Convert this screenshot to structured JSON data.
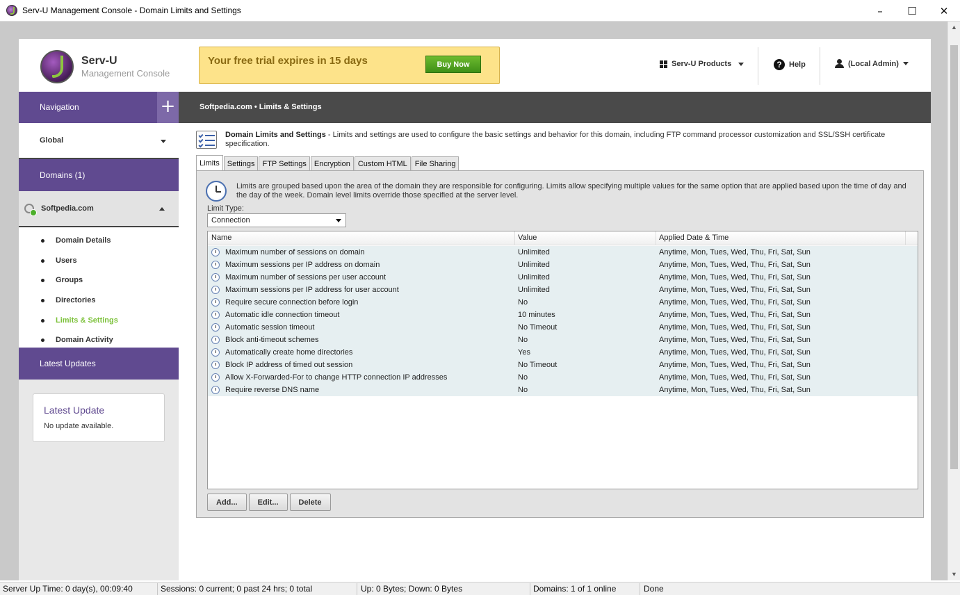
{
  "window": {
    "title": "Serv-U Management Console - Domain Limits and Settings",
    "minimize": "–",
    "maximize": "☐",
    "close": "✕"
  },
  "header": {
    "brand_name": "Serv-U",
    "brand_sub": "Management Console",
    "trial_text": "Your free trial expires in 15 days",
    "buy_label": "Buy Now",
    "products_label": "Serv-U Products",
    "help_label": "Help",
    "user_label": "(Local Admin)"
  },
  "sidebar": {
    "navigation_label": "Navigation",
    "plus": "+",
    "global_label": "Global",
    "domains_label": "Domains (1)",
    "domain_name": "Softpedia.com",
    "items": [
      {
        "label": "Domain Details"
      },
      {
        "label": "Users"
      },
      {
        "label": "Groups"
      },
      {
        "label": "Directories"
      },
      {
        "label": "Limits & Settings",
        "active": true
      },
      {
        "label": "Domain Activity"
      }
    ],
    "updates_label": "Latest Updates",
    "update_card": {
      "title": "Latest Update",
      "text": "No update available."
    }
  },
  "main": {
    "breadcrumb": "Softpedia.com • Limits & Settings",
    "desc_title": "Domain Limits and Settings",
    "desc_text": " - Limits and settings are used to configure the basic settings and behavior for this domain, including FTP command processor customization and SSL/SSH certificate specification.",
    "tabs": [
      "Limits",
      "Settings",
      "FTP Settings",
      "Encryption",
      "Custom HTML",
      "File Sharing"
    ],
    "active_tab": "Limits",
    "panel_desc": "Limits are grouped based upon the area of the domain they are responsible for configuring. Limits allow specifying multiple values for the same option that are applied based upon the time of day and the day of the week. Domain level limits override those specified at the server level.",
    "limit_type_label": "Limit Type:",
    "limit_type_value": "Connection",
    "columns": [
      "Name",
      "Value",
      "Applied Date & Time"
    ],
    "rows": [
      {
        "name": "Maximum number of sessions on domain",
        "value": "Unlimited",
        "applied": "Anytime, Mon, Tues, Wed, Thu, Fri, Sat, Sun"
      },
      {
        "name": "Maximum sessions per IP address on domain",
        "value": "Unlimited",
        "applied": "Anytime, Mon, Tues, Wed, Thu, Fri, Sat, Sun"
      },
      {
        "name": "Maximum number of sessions per user account",
        "value": "Unlimited",
        "applied": "Anytime, Mon, Tues, Wed, Thu, Fri, Sat, Sun"
      },
      {
        "name": "Maximum sessions per IP address for user account",
        "value": "Unlimited",
        "applied": "Anytime, Mon, Tues, Wed, Thu, Fri, Sat, Sun"
      },
      {
        "name": "Require secure connection before login",
        "value": "No",
        "applied": "Anytime, Mon, Tues, Wed, Thu, Fri, Sat, Sun"
      },
      {
        "name": "Automatic idle connection timeout",
        "value": "10 minutes",
        "applied": "Anytime, Mon, Tues, Wed, Thu, Fri, Sat, Sun"
      },
      {
        "name": "Automatic session timeout",
        "value": "No Timeout",
        "applied": "Anytime, Mon, Tues, Wed, Thu, Fri, Sat, Sun"
      },
      {
        "name": "Block anti-timeout schemes",
        "value": "No",
        "applied": "Anytime, Mon, Tues, Wed, Thu, Fri, Sat, Sun"
      },
      {
        "name": "Automatically create home directories",
        "value": "Yes",
        "applied": "Anytime, Mon, Tues, Wed, Thu, Fri, Sat, Sun"
      },
      {
        "name": "Block IP address of timed out session",
        "value": "No Timeout",
        "applied": "Anytime, Mon, Tues, Wed, Thu, Fri, Sat, Sun"
      },
      {
        "name": "Allow X-Forwarded-For to change HTTP connection IP addresses",
        "value": "No",
        "applied": "Anytime, Mon, Tues, Wed, Thu, Fri, Sat, Sun"
      },
      {
        "name": "Require reverse DNS name",
        "value": "No",
        "applied": "Anytime, Mon, Tues, Wed, Thu, Fri, Sat, Sun"
      }
    ],
    "buttons": {
      "add": "Add...",
      "edit": "Edit...",
      "delete": "Delete"
    }
  },
  "statusbar": {
    "uptime": "Server Up Time: 0 day(s), 00:09:40",
    "sessions": "Sessions: 0 current; 0 past 24 hrs; 0 total",
    "transfer": "Up: 0 Bytes; Down: 0 Bytes",
    "domains": "Domains: 1 of 1 online",
    "status": "Done"
  },
  "colors": {
    "nav_purple": "#604a90",
    "active_green": "#7cc13a",
    "breadcrumb_bg": "#4a4a4a",
    "trial_bg": "#fde38a",
    "row_bg": "#e6eff1"
  }
}
